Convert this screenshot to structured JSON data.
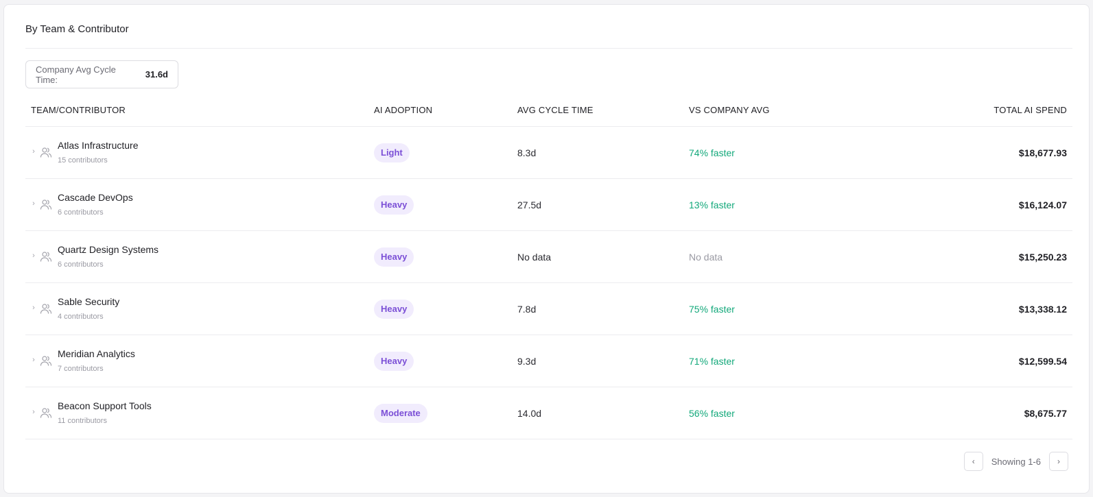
{
  "card": {
    "title": "By Team & Contributor",
    "company_avg": {
      "label": "Company Avg Cycle Time:",
      "value": "31.6d"
    }
  },
  "table": {
    "headers": {
      "team": "TEAM/CONTRIBUTOR",
      "adoption": "AI ADOPTION",
      "cycle": "AVG CYCLE TIME",
      "vs": "VS COMPANY AVG",
      "spend": "TOTAL AI SPEND"
    },
    "rows": [
      {
        "name": "Atlas Infrastructure",
        "contributors": "15 contributors",
        "adoption": "Light",
        "cycle": "8.3d",
        "vs": "74% faster",
        "vs_status": "good",
        "spend": "$18,677.93"
      },
      {
        "name": "Cascade DevOps",
        "contributors": "6 contributors",
        "adoption": "Heavy",
        "cycle": "27.5d",
        "vs": "13% faster",
        "vs_status": "good",
        "spend": "$16,124.07"
      },
      {
        "name": "Quartz Design Systems",
        "contributors": "6 contributors",
        "adoption": "Heavy",
        "cycle": "No data",
        "vs": "No data",
        "vs_status": "none",
        "spend": "$15,250.23"
      },
      {
        "name": "Sable Security",
        "contributors": "4 contributors",
        "adoption": "Heavy",
        "cycle": "7.8d",
        "vs": "75% faster",
        "vs_status": "good",
        "spend": "$13,338.12"
      },
      {
        "name": "Meridian Analytics",
        "contributors": "7 contributors",
        "adoption": "Heavy",
        "cycle": "9.3d",
        "vs": "71% faster",
        "vs_status": "good",
        "spend": "$12,599.54"
      },
      {
        "name": "Beacon Support Tools",
        "contributors": "11 contributors",
        "adoption": "Moderate",
        "cycle": "14.0d",
        "vs": "56% faster",
        "vs_status": "good",
        "spend": "$8,675.77"
      }
    ]
  },
  "pager": {
    "prev": "‹",
    "text": "Showing 1-6",
    "next": "›"
  },
  "icons": {
    "expand": "chevron-right-icon",
    "team": "users-icon"
  },
  "colors": {
    "faster": "#12a87a",
    "badge_bg": "#f1ecfd",
    "badge_text": "#7b4fd6",
    "muted": "#9a9aa3"
  }
}
